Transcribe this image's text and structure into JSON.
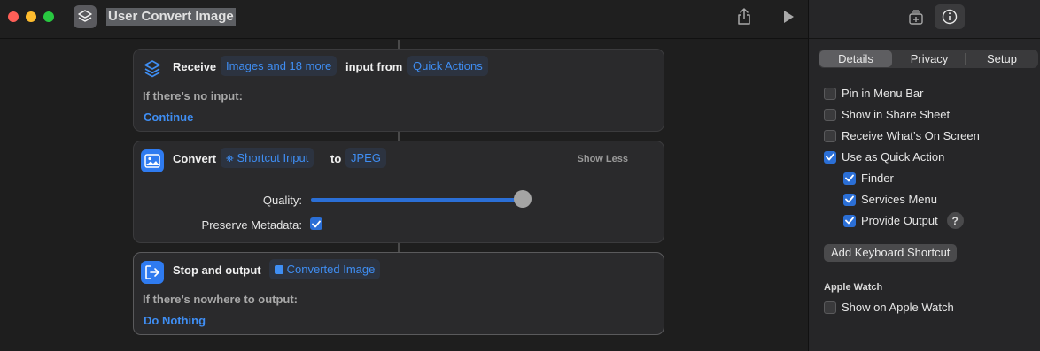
{
  "window": {
    "title": "User Convert Image"
  },
  "actions": {
    "receive": {
      "title": "Receive",
      "types_token": "Images and 18 more",
      "middle_text": "input from",
      "source_token": "Quick Actions",
      "no_input_label": "If there’s no input:",
      "no_input_value": "Continue"
    },
    "convert": {
      "title": "Convert",
      "input_token": "Shortcut Input",
      "to_text": "to",
      "format_token": "JPEG",
      "show_less": "Show Less",
      "quality_label": "Quality:",
      "quality_value": 1.0,
      "preserve_label": "Preserve Metadata:",
      "preserve_checked": true
    },
    "stop": {
      "title": "Stop and output",
      "output_token": "Converted Image",
      "nowhere_label": "If there’s nowhere to output:",
      "nowhere_value": "Do Nothing"
    }
  },
  "inspector": {
    "tabs": [
      {
        "label": "Details",
        "active": true
      },
      {
        "label": "Privacy",
        "active": false
      },
      {
        "label": "Setup",
        "active": false
      }
    ],
    "options": {
      "pin_menu_bar": {
        "label": "Pin in Menu Bar",
        "checked": false
      },
      "share_sheet": {
        "label": "Show in Share Sheet",
        "checked": false
      },
      "on_screen": {
        "label": "Receive What’s On Screen",
        "checked": false
      },
      "quick_action": {
        "label": "Use as Quick Action",
        "checked": true
      },
      "finder": {
        "label": "Finder",
        "checked": true
      },
      "services_menu": {
        "label": "Services Menu",
        "checked": true
      },
      "provide_output": {
        "label": "Provide Output",
        "checked": true
      }
    },
    "help_glyph": "?",
    "keyboard_button": "Add Keyboard Shortcut",
    "watch_heading": "Apple Watch",
    "watch_option": {
      "label": "Show on Apple Watch",
      "checked": false
    }
  },
  "colors": {
    "accent": "#2b6fd6",
    "token_text": "#3f8ef3",
    "background": "#1e1e1e"
  }
}
